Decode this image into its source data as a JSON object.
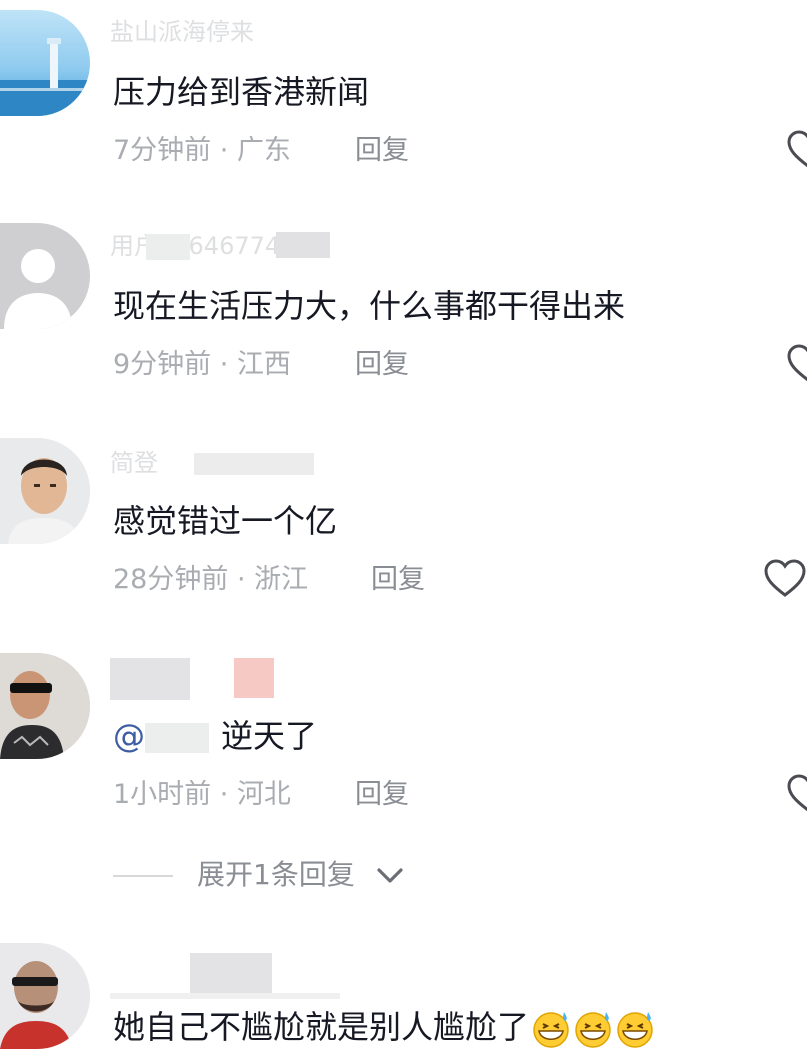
{
  "comments": [
    {
      "username": "盐山派海停来",
      "text": "压力给到香港新闻",
      "time": "7分钟前",
      "location": "广东",
      "reply_label": "回复"
    },
    {
      "username": "用户70646774393",
      "text": "现在生活压力大，什么事都干得出来",
      "time": "9分钟前",
      "location": "江西",
      "reply_label": "回复"
    },
    {
      "username": "简登",
      "text": "感觉错过一个亿",
      "time": "28分钟前",
      "location": "浙江",
      "reply_label": "回复"
    },
    {
      "username": "",
      "mention": "@",
      "text": "逆天了",
      "time": "1小时前",
      "location": "河北",
      "reply_label": "回复",
      "expand_label": "展开1条回复"
    },
    {
      "username": "",
      "text": "她自己不尴尬就是别人尴尬了",
      "emoji": [
        "grinning-sweat-emoji",
        "grinning-sweat-emoji",
        "grinning-sweat-emoji"
      ]
    }
  ],
  "meta_separator": " · ",
  "icons": {
    "like": "heart-outline-icon",
    "expand": "chevron-down-icon"
  },
  "colors": {
    "text": "#161823",
    "meta": "#a9acb1",
    "mention": "#3e5ea3"
  }
}
